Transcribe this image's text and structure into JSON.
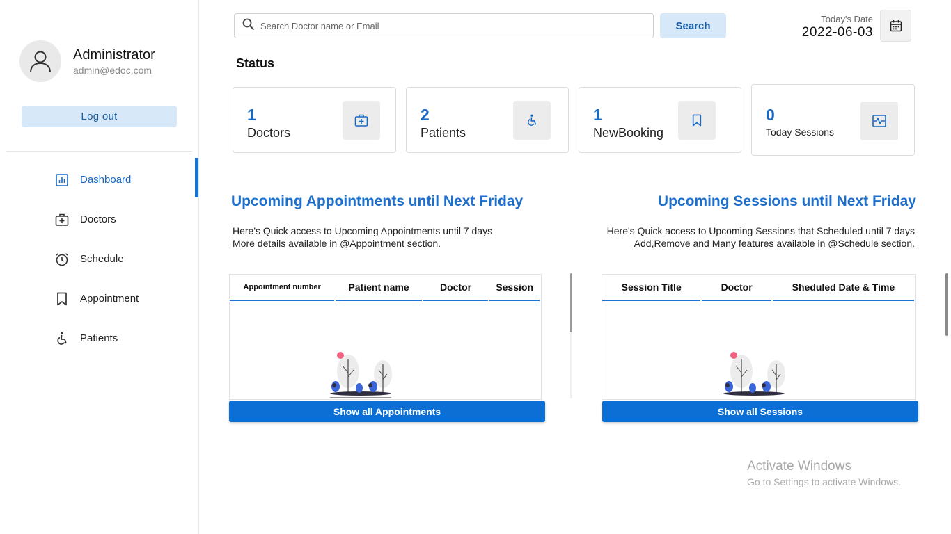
{
  "user": {
    "name": "Administrator",
    "email": "admin@edoc.com",
    "logout_label": "Log out"
  },
  "nav": [
    {
      "label": "Dashboard",
      "icon": "dashboard-icon",
      "active": true
    },
    {
      "label": "Doctors",
      "icon": "doctor-bag-icon"
    },
    {
      "label": "Schedule",
      "icon": "alarm-clock-icon"
    },
    {
      "label": "Appointment",
      "icon": "bookmark-icon"
    },
    {
      "label": "Patients",
      "icon": "wheelchair-icon"
    }
  ],
  "search": {
    "placeholder": "Search Doctor name or Email",
    "button_label": "Search"
  },
  "date": {
    "label": "Today's Date",
    "value": "2022-06-03"
  },
  "status": {
    "title": "Status",
    "cards": [
      {
        "value": "1",
        "label": "Doctors",
        "icon": "medical-bag-icon"
      },
      {
        "value": "2",
        "label": "Patients",
        "icon": "wheelchair-icon"
      },
      {
        "value": "1",
        "label": "NewBooking",
        "icon": "bookmark-icon"
      },
      {
        "value": "0",
        "label": "Today Sessions",
        "icon": "session-icon"
      }
    ]
  },
  "appointments": {
    "title": "Upcoming Appointments until Next Friday",
    "desc1": "Here's Quick access to Upcoming Appointments until 7 days",
    "desc2": "More details available in @Appointment section.",
    "columns": [
      "Appointment number",
      "Patient name",
      "Doctor",
      "Session"
    ],
    "button": "Show all Appointments"
  },
  "sessions": {
    "title": "Upcoming Sessions until Next Friday",
    "desc1": "Here's Quick access to Upcoming Sessions that Scheduled until 7 days",
    "desc2": "Add,Remove and Many features available in @Schedule section.",
    "columns": [
      "Session Title",
      "Doctor",
      "Sheduled Date & Time"
    ],
    "button": "Show all Sessions"
  },
  "watermark": {
    "line1": "Activate Windows",
    "line2": "Go to Settings to activate Windows."
  },
  "colors": {
    "accent": "#1a73d6",
    "light_accent": "#d7e9f9",
    "title_blue": "#1d6fcb"
  }
}
